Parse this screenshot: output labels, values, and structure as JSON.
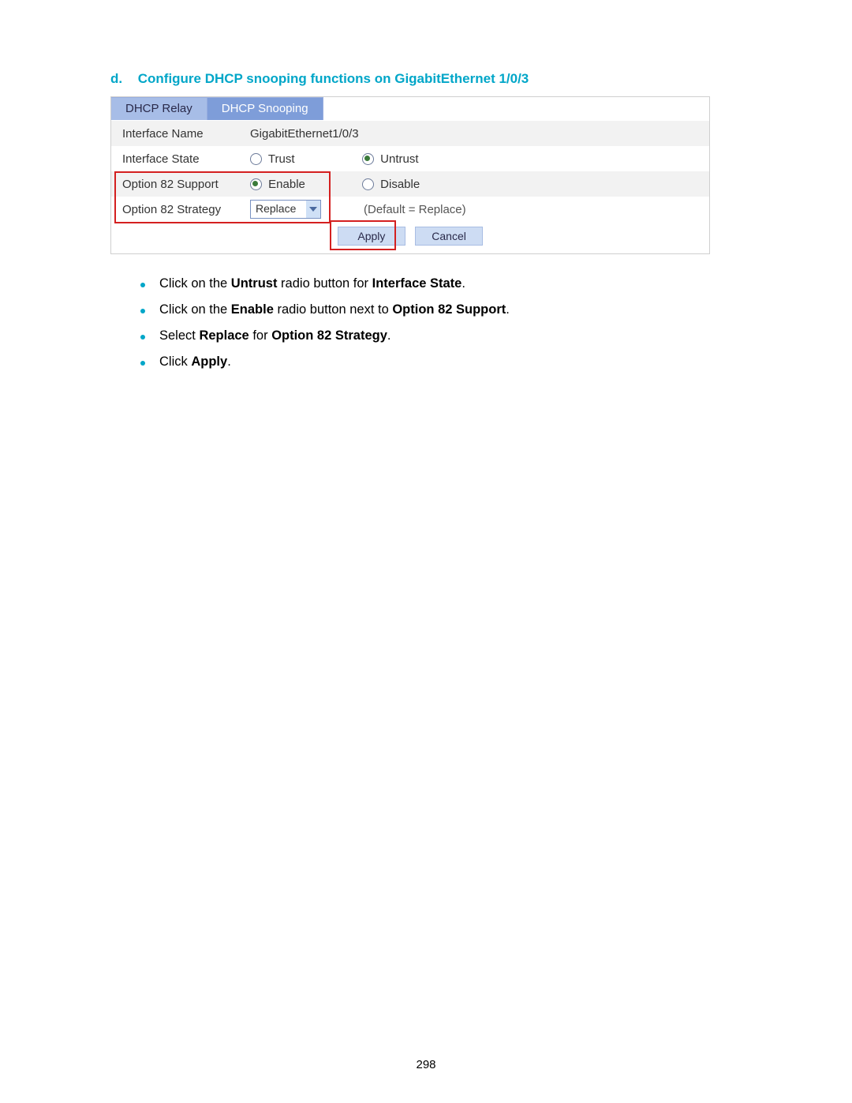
{
  "heading": {
    "prefix": "d.",
    "text": "Configure DHCP snooping functions on GigabitEthernet 1/0/3"
  },
  "screenshot": {
    "tabs": {
      "relay": "DHCP Relay",
      "snoop": "DHCP Snooping"
    },
    "rows": {
      "iface_name": {
        "label": "Interface Name",
        "value": "GigabitEthernet1/0/3"
      },
      "iface_state": {
        "label": "Interface State",
        "trust": "Trust",
        "untrust": "Untrust"
      },
      "opt82_support": {
        "label": "Option 82 Support",
        "enable": "Enable",
        "disable": "Disable"
      },
      "opt82_strategy": {
        "label": "Option 82 Strategy",
        "select_value": "Replace",
        "default_note": "(Default = Replace)"
      }
    },
    "buttons": {
      "apply": "Apply",
      "cancel": "Cancel"
    }
  },
  "instructions": {
    "b1_pre": "Click on the ",
    "b1_bold1": "Untrust",
    "b1_mid": " radio button for ",
    "b1_bold2": "Interface State",
    "b1_post": ".",
    "b2_pre": "Click on the ",
    "b2_bold1": "Enable",
    "b2_mid": " radio button next to ",
    "b2_bold2": "Option 82 Support",
    "b2_post": ".",
    "b3_pre": "Select ",
    "b3_bold1": "Replace",
    "b3_mid": " for ",
    "b3_bold2": "Option 82 Strategy",
    "b3_post": ".",
    "b4_pre": "Click ",
    "b4_bold1": "Apply",
    "b4_post": "."
  },
  "page_number": "298"
}
